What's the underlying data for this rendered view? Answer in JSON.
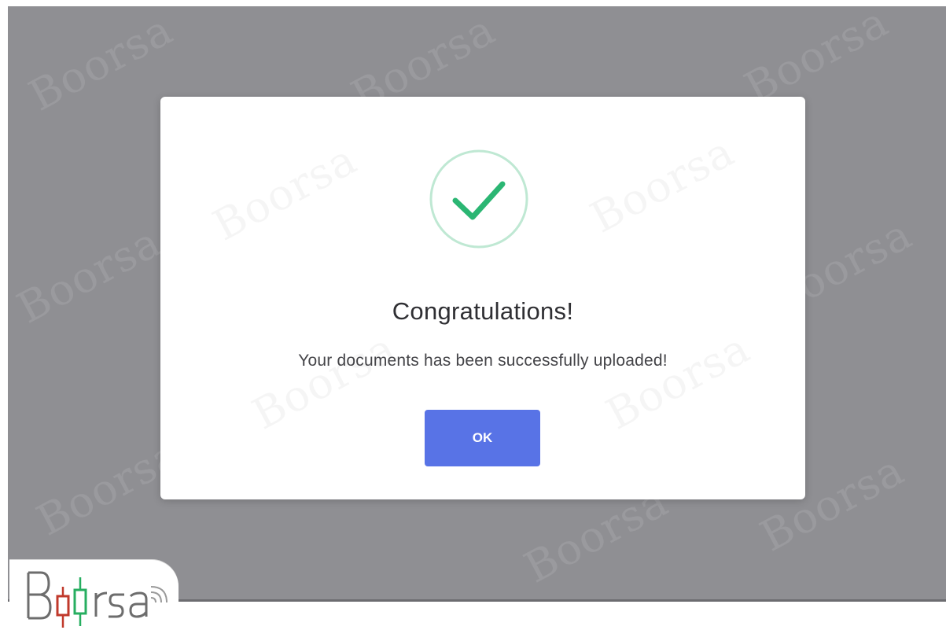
{
  "dialog": {
    "title": "Congratulations!",
    "message": "Your documents has been successfully uploaded!",
    "ok_label": "OK",
    "icon": "check-circle-icon"
  },
  "watermark": {
    "text": "Boorsa"
  },
  "logo": {
    "text": "Boorsa"
  },
  "colors": {
    "overlay": "#8f8f93",
    "dialog_bg": "#ffffff",
    "success_green": "#2bb673",
    "ring_green": "#bfe8d3",
    "button_blue": "#5873e6",
    "logo_red": "#c0392b",
    "logo_green": "#27ae60",
    "logo_gray": "#6d6d6d"
  }
}
